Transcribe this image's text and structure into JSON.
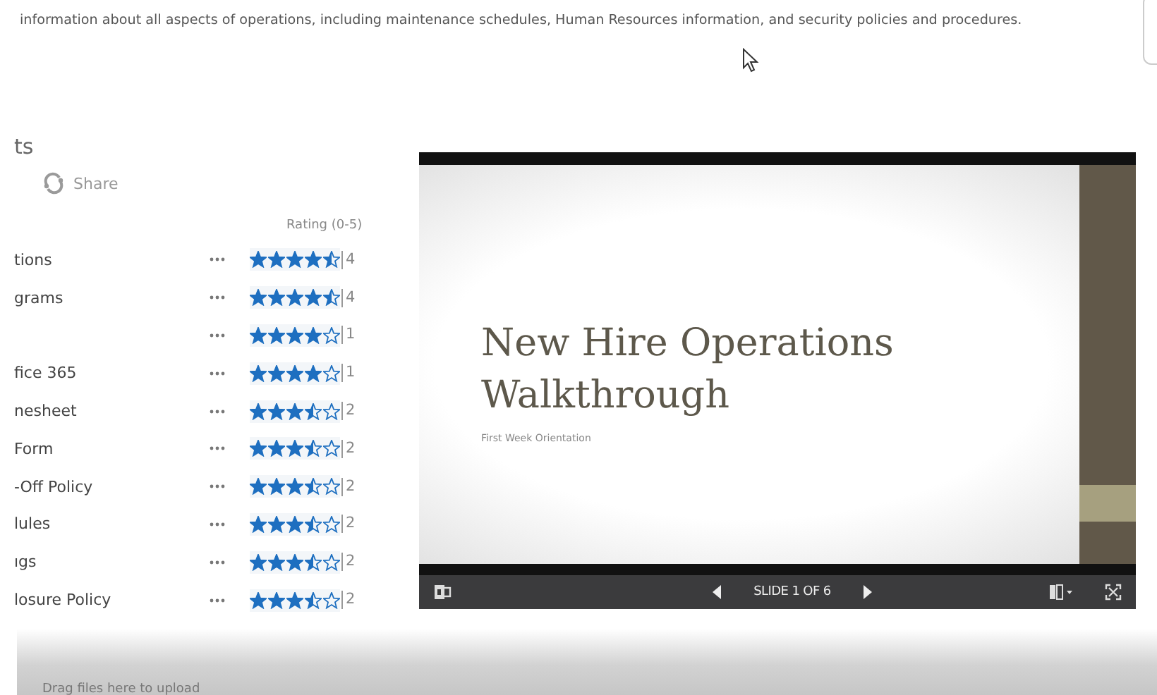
{
  "header": {
    "description": "information about all aspects of operations, including maintenance schedules, Human Resources information, and security policies and procedures."
  },
  "library": {
    "title": "ts",
    "share": "Share",
    "rating_header": "Rating (0-5)"
  },
  "rows": [
    {
      "name": "tions",
      "stars": 4.5,
      "count": "4"
    },
    {
      "name": "grams",
      "stars": 4.5,
      "count": "4"
    },
    {
      "stars": 4,
      "count": "1"
    },
    {
      "name": "fice 365",
      "stars": 4,
      "count": "1"
    },
    {
      "name": "nesheet",
      "stars": 3.5,
      "count": "2"
    },
    {
      "name": "Form",
      "stars": 3.5,
      "count": "2"
    },
    {
      "name": "-Off Policy",
      "stars": 3.5,
      "count": "2"
    },
    {
      "name": "lules",
      "stars": 3.5,
      "count": "2"
    },
    {
      "name": "ıgs",
      "stars": 3.5,
      "count": "2"
    },
    {
      "name": "losure Policy",
      "stars": 3.5,
      "count": "2"
    }
  ],
  "viewer": {
    "title": "New Hire Operations Walkthrough",
    "subtitle": "First Week Orientation",
    "counter": "SLIDE 1 OF 6"
  },
  "upload": {
    "hint": "Drag files here to upload"
  }
}
